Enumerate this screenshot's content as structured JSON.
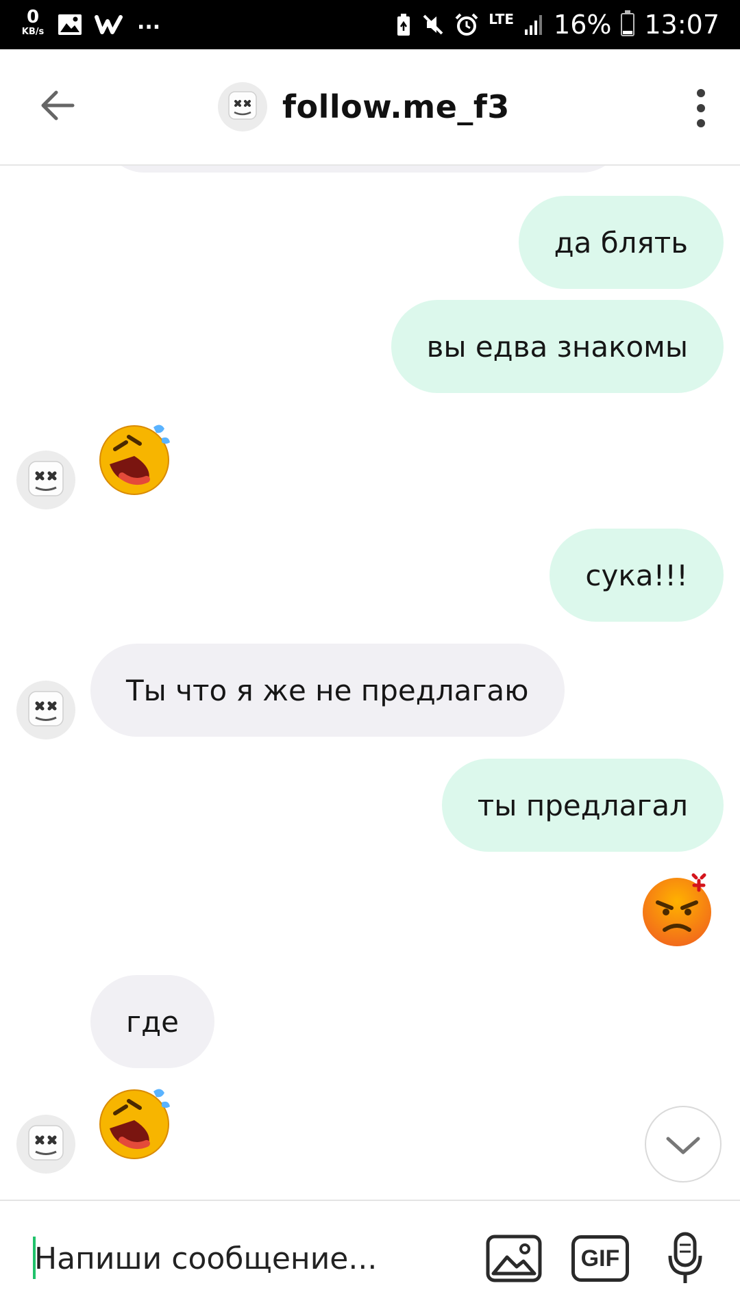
{
  "status_bar": {
    "speed_value": "0",
    "speed_unit": "KB/s",
    "more": "...",
    "network": "LTE",
    "battery": "16%",
    "time": "13:07"
  },
  "header": {
    "title": "follow.me_f3"
  },
  "messages": [
    {
      "direction": "out",
      "text": "да блять"
    },
    {
      "direction": "out",
      "text": "вы едва знакомы"
    },
    {
      "direction": "in",
      "emoji": "rolling-on-floor-laughing"
    },
    {
      "direction": "out",
      "text": "сука!!!"
    },
    {
      "direction": "in",
      "text": "Ты что я же не предлагаю"
    },
    {
      "direction": "out",
      "text": "ты предлагал"
    },
    {
      "direction": "out",
      "emoji": "angry-face"
    },
    {
      "direction": "in",
      "text": "где"
    },
    {
      "direction": "in",
      "emoji": "rolling-on-floor-laughing"
    }
  ],
  "composer": {
    "placeholder": "Напиши сообщение...",
    "gif_label": "GIF"
  },
  "colors": {
    "outgoing_bubble": "#dcf8ec",
    "incoming_bubble": "#f1f0f4",
    "cursor": "#20c26b"
  }
}
